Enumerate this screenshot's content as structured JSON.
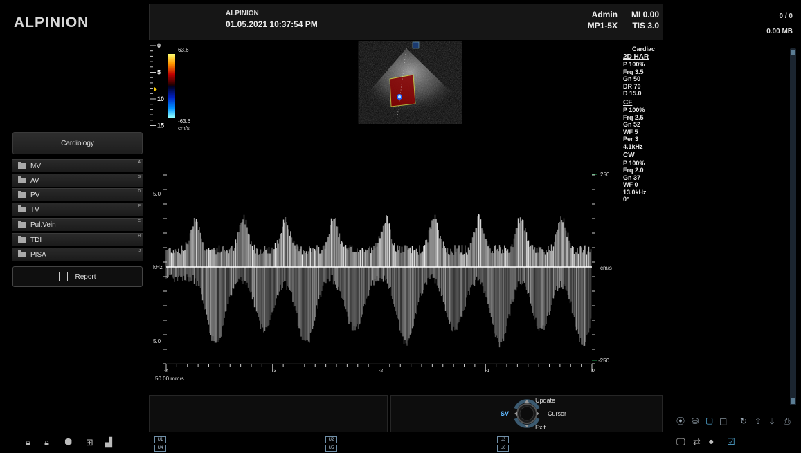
{
  "header": {
    "logo": "ALPINION",
    "brand": "ALPINION",
    "datetime": "01.05.2021  10:37:54 PM",
    "user": "Admin",
    "probe": "MP1-5X",
    "mi": "MI 0.00",
    "tis": "TIS 3.0",
    "image_count": "0 / 0",
    "storage": "0.00 MB"
  },
  "sidebar": {
    "category": "Cardiology",
    "items": [
      {
        "label": "MV",
        "hotkey": "A"
      },
      {
        "label": "AV",
        "hotkey": "S"
      },
      {
        "label": "PV",
        "hotkey": "D"
      },
      {
        "label": "TV",
        "hotkey": "F"
      },
      {
        "label": "Pul.Vein",
        "hotkey": "G"
      },
      {
        "label": "TDI",
        "hotkey": "H"
      },
      {
        "label": "PISA",
        "hotkey": "J"
      }
    ],
    "report": "Report"
  },
  "color_scale": {
    "max": "63.6",
    "min": "-63.6",
    "unit": "cm/s",
    "colors": [
      "#ffff60",
      "#ff9000",
      "#c00000",
      "#300000",
      "#000030",
      "#0030c0",
      "#0090ff",
      "#80ffff"
    ]
  },
  "depth_scale": {
    "labels": [
      "0",
      "5",
      "10",
      "15"
    ]
  },
  "params": {
    "preset": "Cardiac",
    "mode_2d": "2D HAR",
    "lines_2d": [
      "P 100%",
      "Frq 3.5",
      "Gn 50",
      "DR 70",
      "D 15.0"
    ],
    "mode_cf": "CF",
    "lines_cf": [
      "P 100%",
      "Frq 2.5",
      "Gn 52",
      "WF 5",
      "Per 3",
      "4.1kHz"
    ],
    "mode_cw": "CW",
    "lines_cw": [
      "P 100%",
      "Frq 2.0",
      "Gn 37",
      "WF 0",
      "13.0kHz",
      "0°"
    ]
  },
  "doppler": {
    "left_top": "5.0",
    "left_mid": "kHz",
    "left_bottom": "5.0",
    "right_top": "250",
    "right_mid": "cm/s",
    "right_bottom": "-250",
    "time_labels": [
      "-4",
      "-3",
      "-2",
      "-1",
      "0"
    ],
    "sweep": "50.00 mm/s"
  },
  "control": {
    "sv": "SV",
    "update": "Update",
    "cursor": "Cursor",
    "exit": "Exit"
  },
  "user_keys": [
    "U1",
    "U2",
    "U3",
    "U4",
    "U5",
    "U6"
  ],
  "colors": {
    "accent": "#5b7d94",
    "doppler_marker": "#1fa050"
  }
}
